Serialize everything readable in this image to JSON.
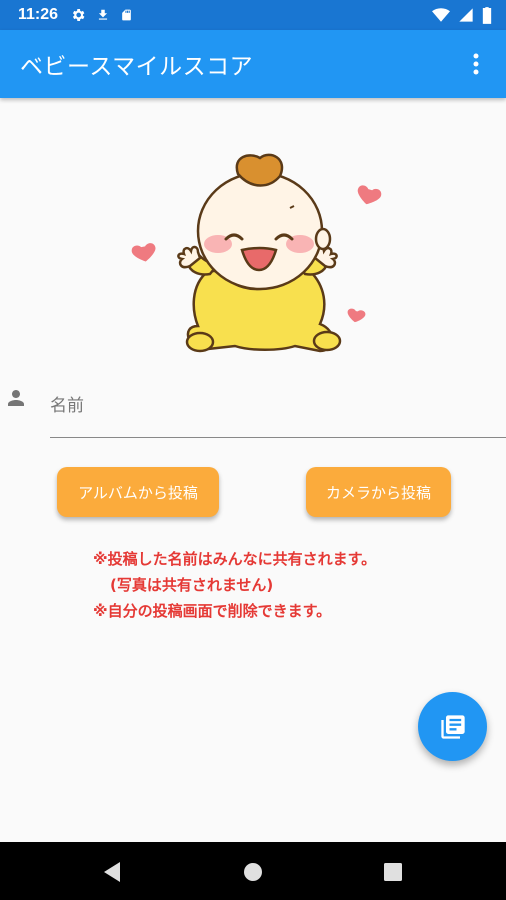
{
  "status_bar": {
    "time": "11:26",
    "icons_left": [
      "gear-icon",
      "download-icon",
      "sd-card-icon"
    ],
    "icons_right": [
      "wifi-icon",
      "signal-icon",
      "battery-icon"
    ]
  },
  "app_bar": {
    "title": "ベビースマイルスコア",
    "menu_icon": "more-vert-icon",
    "color": "#2196f3"
  },
  "form": {
    "name_placeholder": "名前",
    "name_value": ""
  },
  "buttons": {
    "album": "アルバムから投稿",
    "camera": "カメラから投稿",
    "color": "#fbab3c"
  },
  "notices": {
    "line1": "※投稿した名前はみんなに共有されます。",
    "line2": "(写真は共有されません)",
    "line3": "※自分の投稿画面で削除できます。",
    "color": "#e53935"
  },
  "fab": {
    "icon": "library-books-icon"
  },
  "nav_bar": {
    "icons": [
      "back-icon",
      "home-icon",
      "recents-icon"
    ]
  }
}
